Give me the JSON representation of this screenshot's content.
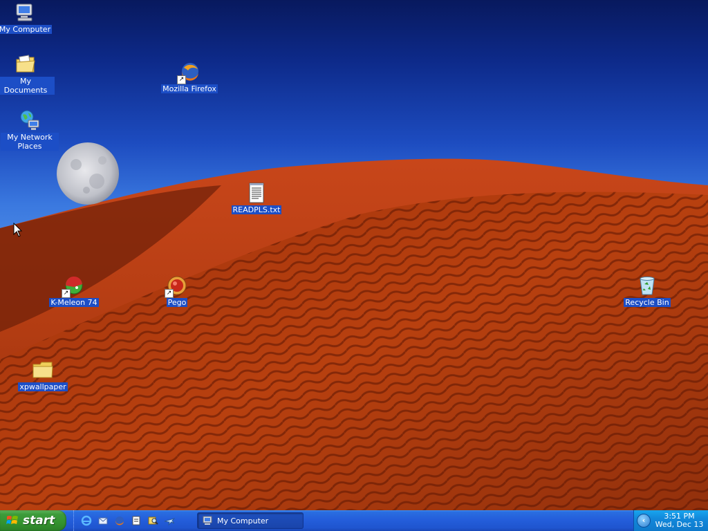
{
  "desktop": {
    "icons": [
      {
        "key": "my-computer",
        "label": "My Computer",
        "shortcut": false
      },
      {
        "key": "my-documents",
        "label": "My Documents",
        "shortcut": false
      },
      {
        "key": "my-network-places",
        "label": "My Network Places",
        "shortcut": false
      },
      {
        "key": "mozilla-firefox",
        "label": "Mozilla Firefox",
        "shortcut": true
      },
      {
        "key": "readpls",
        "label": "READPLS.txt",
        "shortcut": false
      },
      {
        "key": "k-meleon",
        "label": "K-Meleon 74",
        "shortcut": true
      },
      {
        "key": "pego",
        "label": "Pego",
        "shortcut": true
      },
      {
        "key": "recycle-bin",
        "label": "Recycle Bin",
        "shortcut": false
      },
      {
        "key": "xpwallpaper",
        "label": "xpwallpaper",
        "shortcut": false
      }
    ]
  },
  "taskbar": {
    "start_label": "start",
    "quick_launch": [
      "internet-explorer-icon",
      "outlook-express-icon",
      "firefox-icon",
      "notepad-icon",
      "search-icon",
      "plane-icon"
    ],
    "tasks": [
      {
        "label": "My Computer",
        "icon": "my-computer-icon"
      }
    ],
    "clock": {
      "time": "3:51 PM",
      "date": "Wed, Dec 13"
    }
  },
  "colors": {
    "selection": "#1c4ec6",
    "taskbar": "#245edb",
    "start": "#3c9b3a",
    "tray": "#0f7acb"
  }
}
